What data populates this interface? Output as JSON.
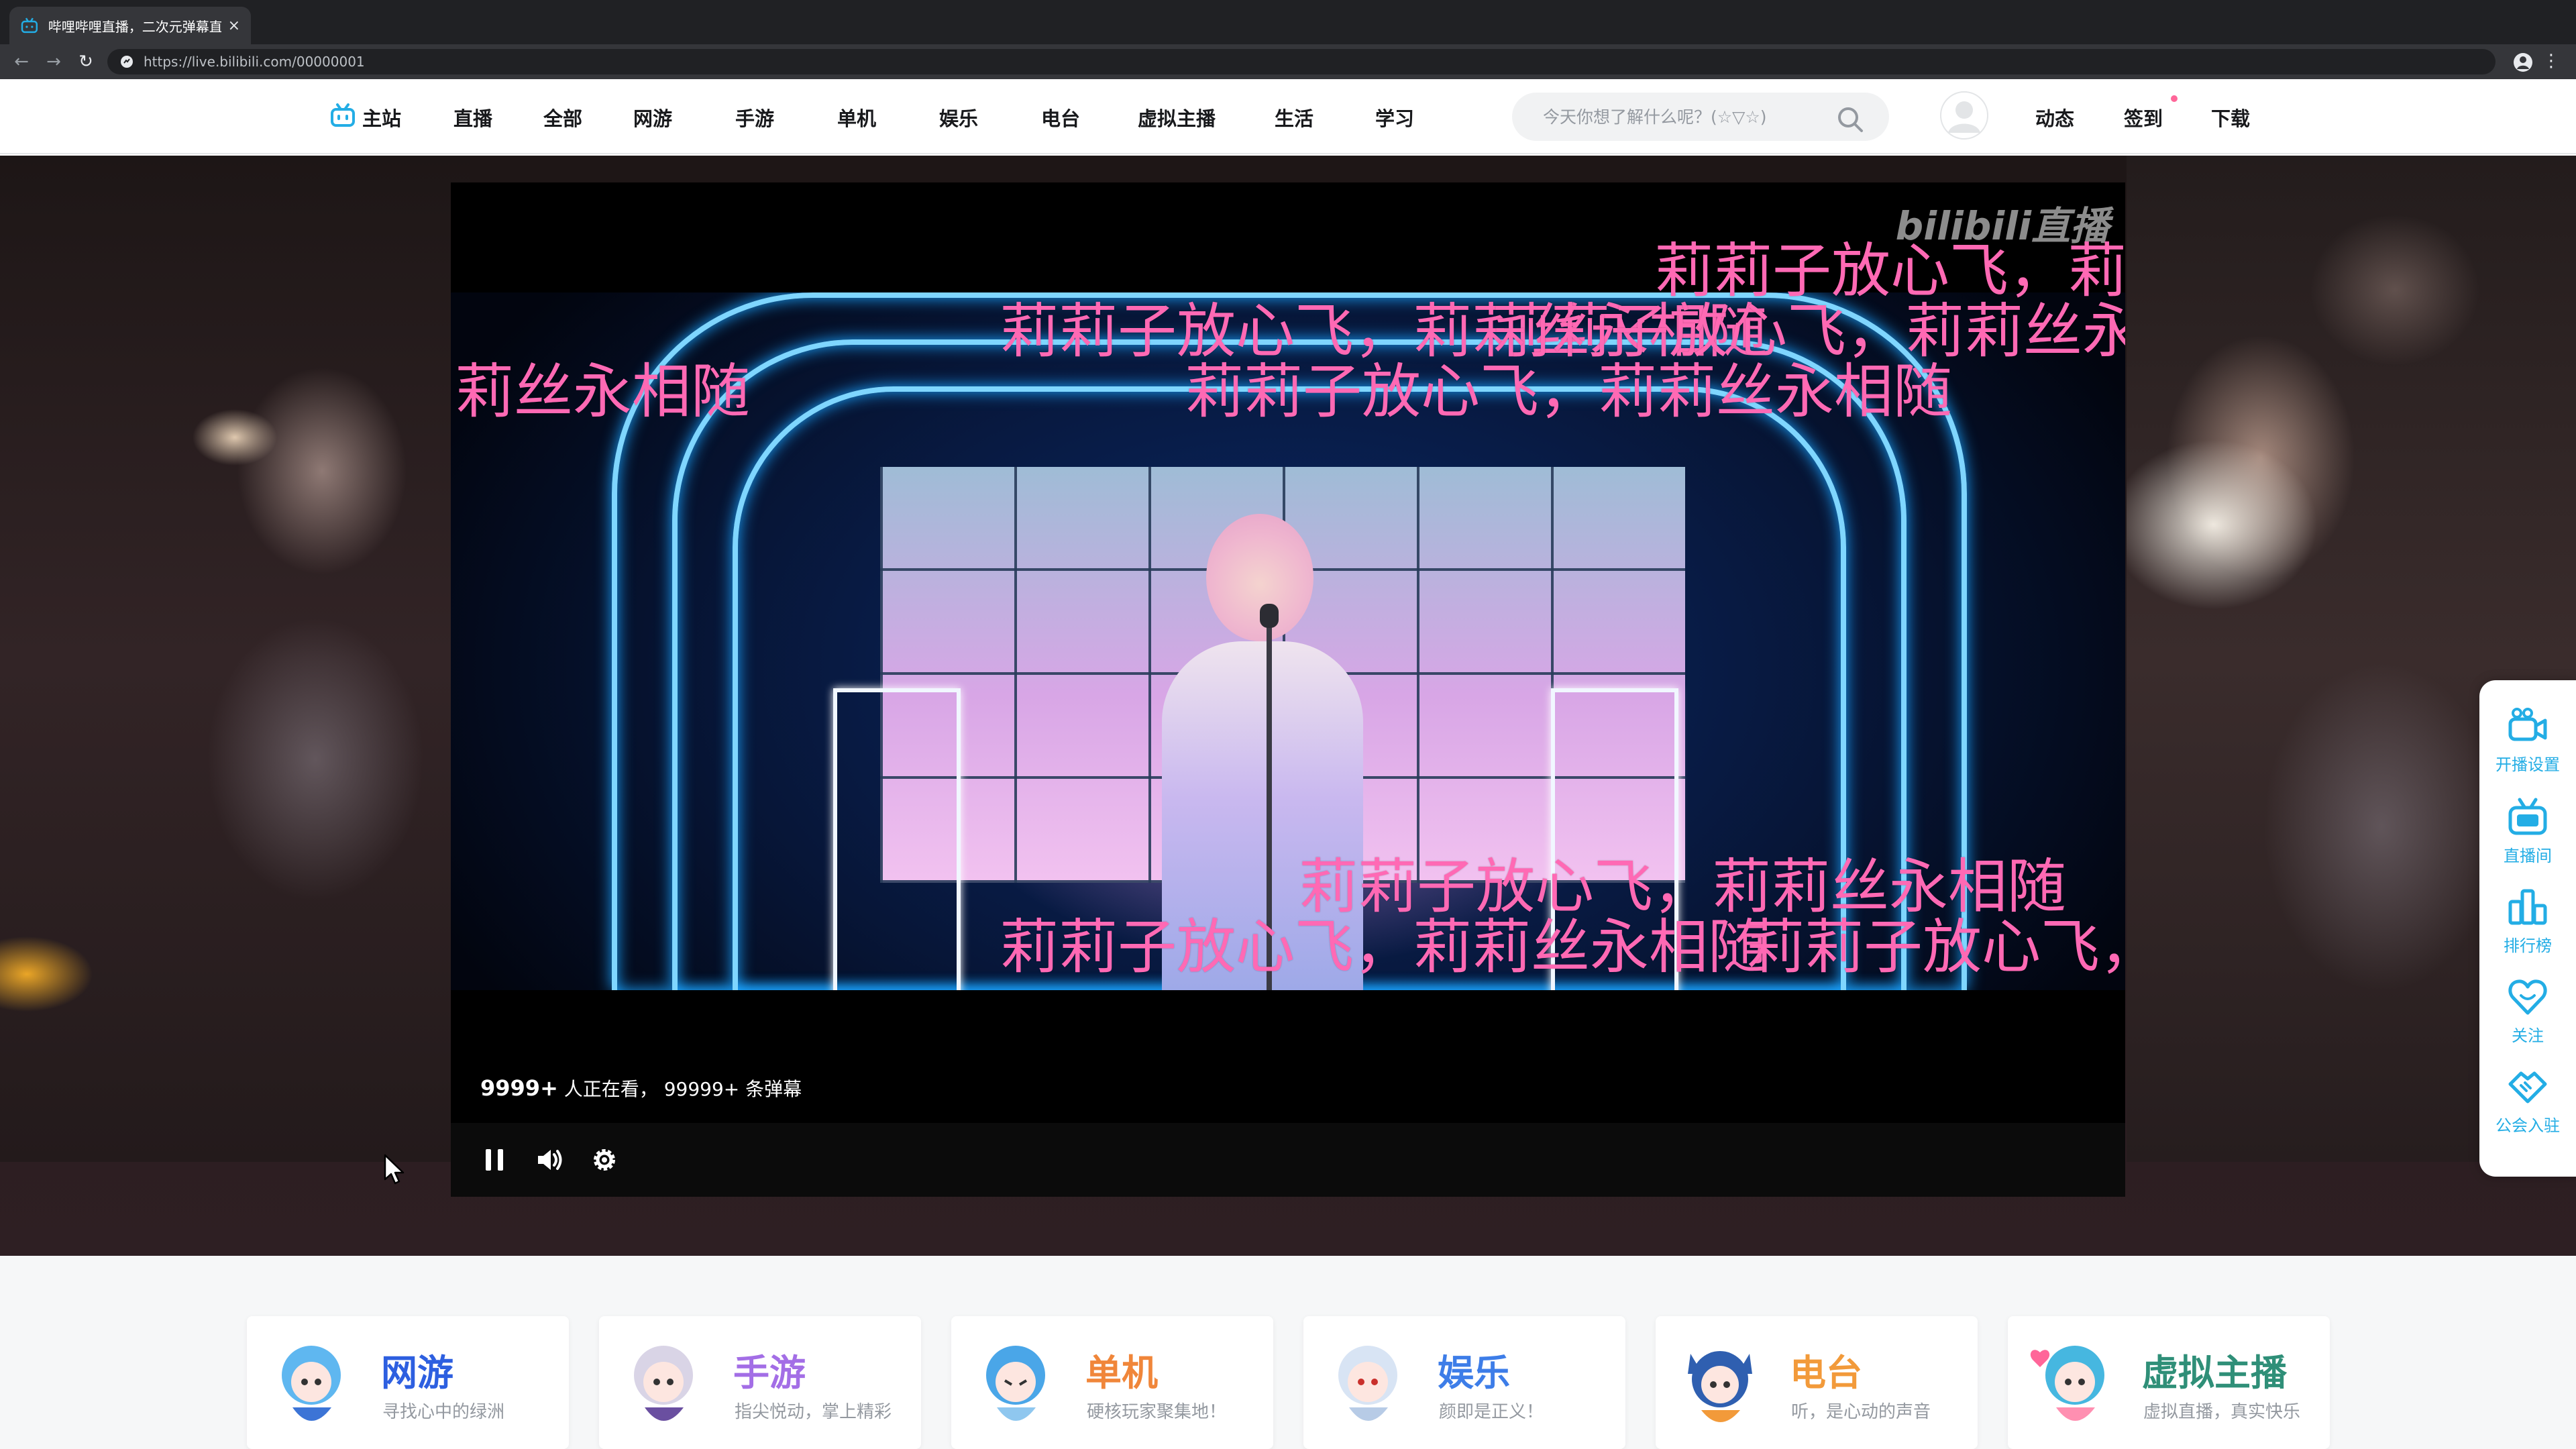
{
  "browser": {
    "tab_title": "哔哩哔哩直播，二次元弹幕直播",
    "tab_close": "×",
    "url": "https://live.bilibili.com/00000001"
  },
  "nav": {
    "home": "主站",
    "items": [
      "直播",
      "全部",
      "网游",
      "手游",
      "单机",
      "娱乐",
      "电台",
      "虚拟主播",
      "生活",
      "学习"
    ],
    "search_placeholder": "今天你想了解什么呢？(☆▽☆)",
    "dynamic": "动态",
    "signin": "签到",
    "download": "下载"
  },
  "player": {
    "watermark": "bilibili直播",
    "danmaku": [
      "莉莉子放心飞，莉莉",
      "莉莉子放心飞，莉莉丝永相随",
      "莉丝永相随",
      "莉莉子放心飞，莉莉丝永",
      "莉莉子放心飞，莉莉丝永相随",
      "莉莉子放心飞，莉莉丝永相随",
      "莉莉子放心飞，莉莉丝永相随",
      "莉莉子放心飞，"
    ],
    "viewers_count": "9999+",
    "viewers_label": "人正在看，",
    "danmaku_count": "99999+",
    "danmaku_label": "条弹幕"
  },
  "dock": {
    "items": [
      "开播设置",
      "直播间",
      "排行榜",
      "关注",
      "公会入驻"
    ]
  },
  "categories": [
    {
      "title": "网游",
      "subtitle": "寻找心中的绿洲",
      "color": "#2d5fe0"
    },
    {
      "title": "手游",
      "subtitle": "指尖悦动，掌上精彩",
      "color": "#a36ee6"
    },
    {
      "title": "单机",
      "subtitle": "硬核玩家聚集地！",
      "color": "#f0863a"
    },
    {
      "title": "娱乐",
      "subtitle": "颜即是正义！",
      "color": "#3d7de8"
    },
    {
      "title": "电台",
      "subtitle": "听，是心动的声音",
      "color": "#f29a3a"
    },
    {
      "title": "虚拟主播",
      "subtitle": "虚拟直播，真实快乐",
      "color": "#2f8f78"
    }
  ],
  "colors": {
    "accent": "#23ade5",
    "danmaku": "#ff69b4",
    "brand_pink": "#ff6699"
  }
}
